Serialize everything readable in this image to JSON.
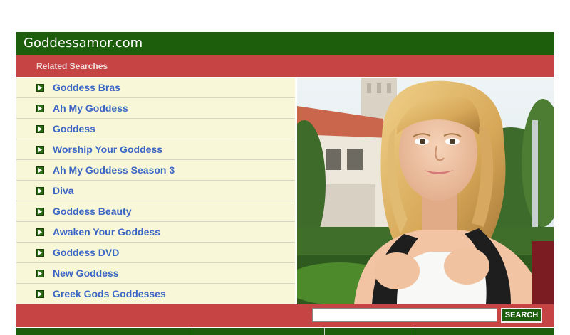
{
  "header": {
    "title": "Goddessamor.com"
  },
  "related": {
    "label": "Related Searches",
    "items": [
      "Goddess Bras",
      "Ah My Goddess",
      "Goddess",
      "Worship Your Goddess",
      "Ah My Goddess Season 3",
      "Diva",
      "Goddess Beauty",
      "Awaken Your Goddess",
      "Goddess DVD",
      "New Goddess",
      "Greek Gods Goddesses"
    ]
  },
  "search": {
    "value": "",
    "button_label": "SEARCH"
  },
  "colors": {
    "header_green": "#1d5e0c",
    "bar_red": "#c64444",
    "list_bg": "#f8f8d8",
    "link_blue": "#3d67c4"
  }
}
